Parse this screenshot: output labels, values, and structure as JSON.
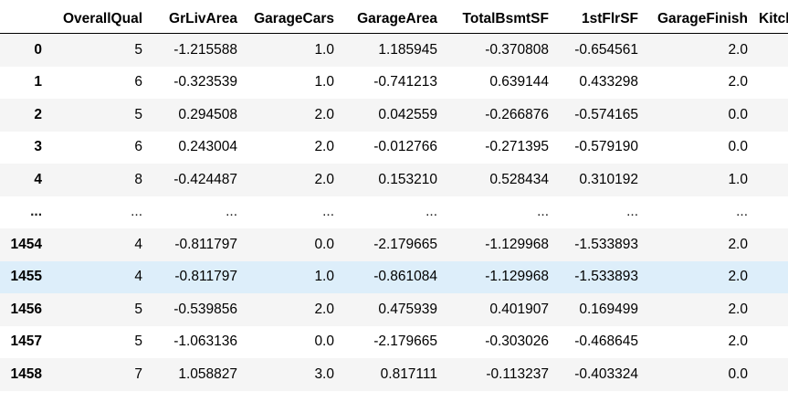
{
  "columns": [
    "",
    "OverallQual",
    "GrLivArea",
    "GarageCars",
    "GarageArea",
    "TotalBsmtSF",
    "1stFlrSF",
    "GarageFinish",
    "Kitch"
  ],
  "rows": [
    {
      "index": "0",
      "cells": [
        "5",
        "-1.215588",
        "1.0",
        "1.185945",
        "-0.370808",
        "-0.654561",
        "2.0",
        ""
      ]
    },
    {
      "index": "1",
      "cells": [
        "6",
        "-0.323539",
        "1.0",
        "-0.741213",
        "0.639144",
        "0.433298",
        "2.0",
        ""
      ]
    },
    {
      "index": "2",
      "cells": [
        "5",
        "0.294508",
        "2.0",
        "0.042559",
        "-0.266876",
        "-0.574165",
        "0.0",
        ""
      ]
    },
    {
      "index": "3",
      "cells": [
        "6",
        "0.243004",
        "2.0",
        "-0.012766",
        "-0.271395",
        "-0.579190",
        "0.0",
        ""
      ]
    },
    {
      "index": "4",
      "cells": [
        "8",
        "-0.424487",
        "2.0",
        "0.153210",
        "0.528434",
        "0.310192",
        "1.0",
        ""
      ]
    },
    {
      "index": "...",
      "cells": [
        "...",
        "...",
        "...",
        "...",
        "...",
        "...",
        "...",
        ""
      ]
    },
    {
      "index": "1454",
      "cells": [
        "4",
        "-0.811797",
        "0.0",
        "-2.179665",
        "-1.129968",
        "-1.533893",
        "2.0",
        ""
      ]
    },
    {
      "index": "1455",
      "cells": [
        "4",
        "-0.811797",
        "1.0",
        "-0.861084",
        "-1.129968",
        "-1.533893",
        "2.0",
        ""
      ]
    },
    {
      "index": "1456",
      "cells": [
        "5",
        "-0.539856",
        "2.0",
        "0.475939",
        "0.401907",
        "0.169499",
        "2.0",
        ""
      ]
    },
    {
      "index": "1457",
      "cells": [
        "5",
        "-1.063136",
        "0.0",
        "-2.179665",
        "-0.303026",
        "-0.468645",
        "2.0",
        ""
      ]
    },
    {
      "index": "1458",
      "cells": [
        "7",
        "1.058827",
        "3.0",
        "0.817111",
        "-0.113237",
        "-0.403324",
        "0.0",
        ""
      ]
    }
  ],
  "highlighted_row_index": "1455",
  "colors": {
    "odd_row": "#f5f5f5",
    "even_row": "#ffffff",
    "hover_row": "#ddeefa",
    "header_border": "#000000"
  }
}
